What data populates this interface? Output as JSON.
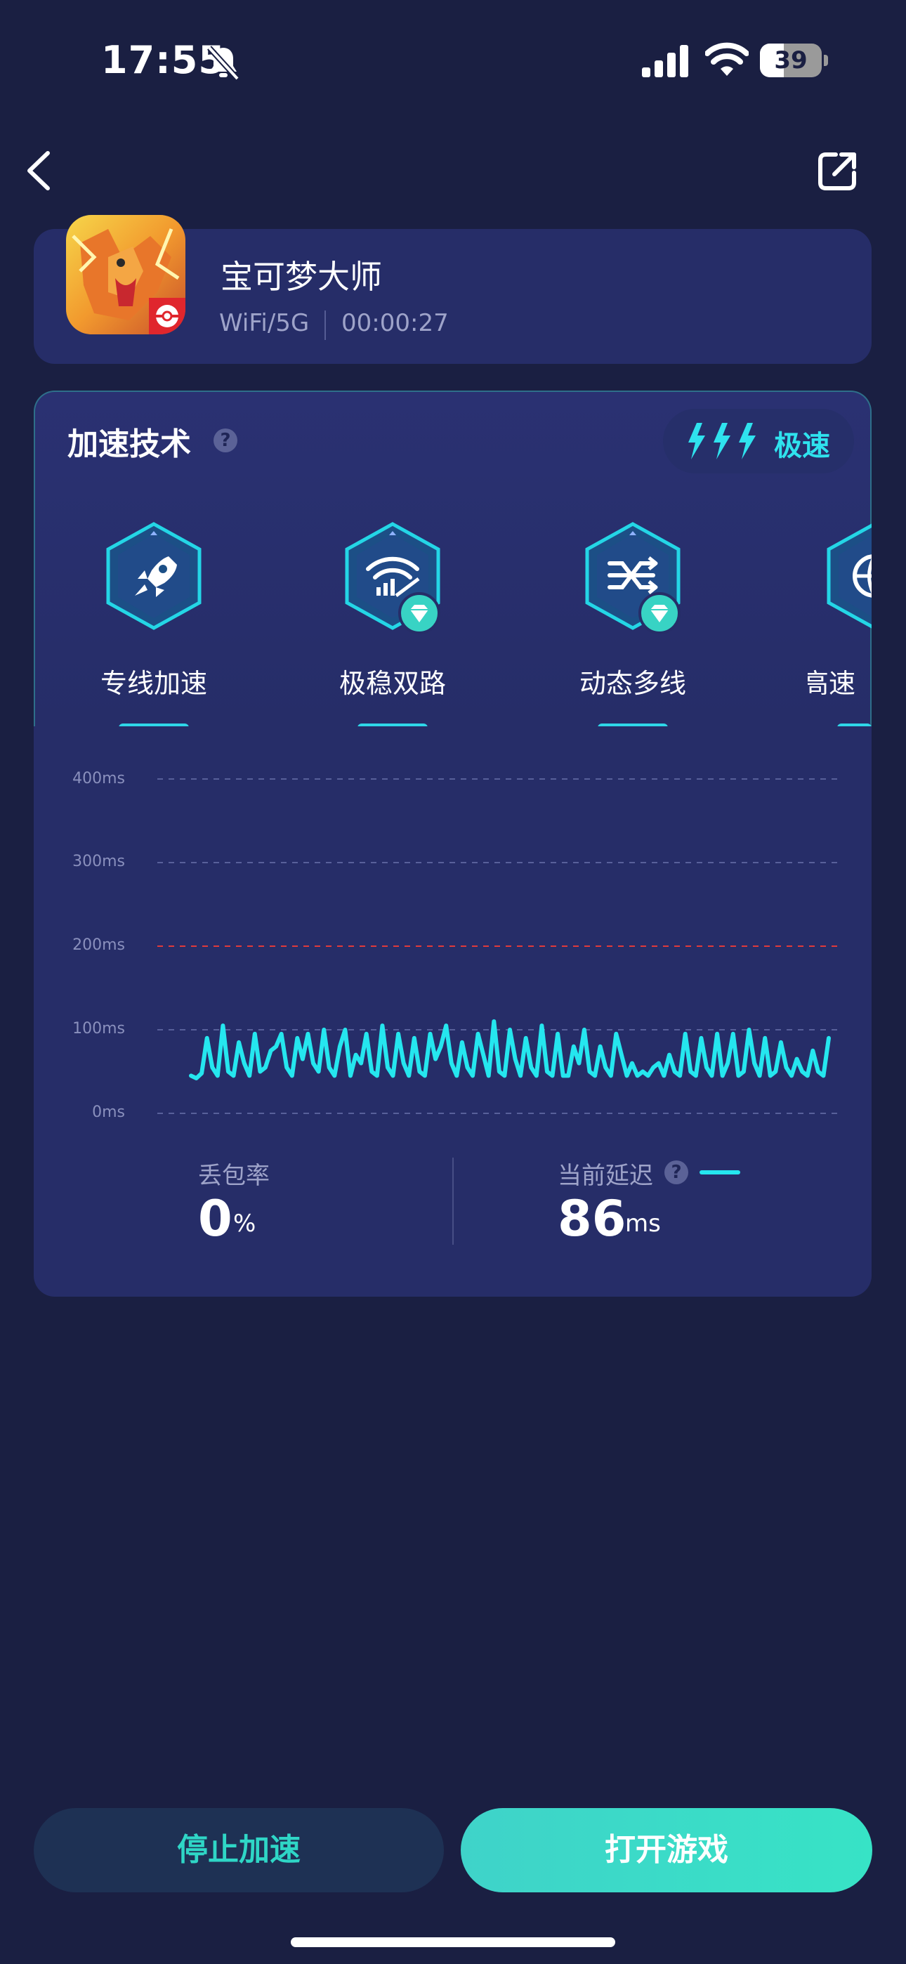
{
  "status_bar": {
    "time": "17:55",
    "battery_level": "39",
    "battery_fraction": 0.39
  },
  "nav": {
    "back_icon": "chevron-left-icon",
    "share_icon": "share-external-icon"
  },
  "game": {
    "name": "宝可梦大师",
    "network": "WiFi/5G",
    "elapsed": "00:00:27"
  },
  "tech": {
    "title": "加速技术",
    "mode_label": "极速",
    "features": [
      {
        "label": "专线加速",
        "icon": "rocket-icon",
        "premium": false
      },
      {
        "label": "极稳双路",
        "icon": "dual-wifi-icon",
        "premium": true
      },
      {
        "label": "动态多线",
        "icon": "multi-route-icon",
        "premium": true
      },
      {
        "label": "高速",
        "icon": "globe-icon",
        "premium": false
      }
    ]
  },
  "chart_data": {
    "type": "line",
    "y_ticks": [
      "400ms",
      "300ms",
      "200ms",
      "100ms",
      "0ms"
    ],
    "ylim": [
      0,
      400
    ],
    "threshold": 200,
    "series": [
      {
        "values": [
          45,
          42,
          48,
          90,
          55,
          45,
          105,
          50,
          45,
          85,
          60,
          45,
          95,
          50,
          55,
          75,
          80,
          95,
          55,
          45,
          90,
          65,
          95,
          60,
          50,
          100,
          55,
          45,
          80,
          100,
          45,
          70,
          60,
          95,
          50,
          45,
          105,
          55,
          45,
          95,
          60,
          45,
          90,
          50,
          45,
          95,
          65,
          80,
          105,
          60,
          45,
          85,
          55,
          45,
          95,
          70,
          45,
          110,
          50,
          45,
          100,
          65,
          45,
          90,
          55,
          45,
          105,
          50,
          45,
          95,
          45,
          45,
          80,
          60,
          100,
          50,
          45,
          80,
          55,
          45,
          95,
          70,
          45,
          60,
          45,
          50,
          45,
          55,
          60,
          45,
          70,
          50,
          45,
          95,
          50,
          45,
          90,
          55,
          45,
          95,
          45,
          60,
          95,
          45,
          50,
          100,
          60,
          45,
          90,
          45,
          50,
          85,
          55,
          45,
          65,
          50,
          45,
          75,
          50,
          45,
          90
        ]
      }
    ],
    "grid": true
  },
  "stats": {
    "loss_label": "丢包率",
    "loss_value": "0",
    "loss_unit": "%",
    "latency_label": "当前延迟",
    "latency_value": "86",
    "latency_unit": "ms"
  },
  "actions": {
    "stop_label": "停止加速",
    "open_label": "打开游戏"
  },
  "colors": {
    "accent": "#25e6ef",
    "threshold": "#e03a3a",
    "background": "#1a1f42",
    "card": "#262d68"
  }
}
